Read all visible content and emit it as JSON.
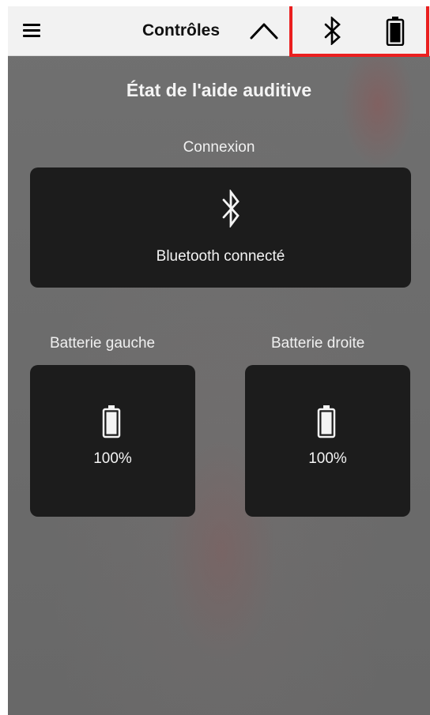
{
  "header": {
    "title": "Contrôles",
    "menu_icon": "hamburger-menu-icon",
    "collapse_icon": "chevron-up-icon",
    "status_icons": [
      "bluetooth-icon",
      "battery-full-icon"
    ],
    "highlight_color": "#ea1f1f"
  },
  "main": {
    "heading": "État de l'aide auditive",
    "connection": {
      "label": "Connexion",
      "status": "Bluetooth connecté",
      "icon": "bluetooth-icon"
    },
    "battery_left": {
      "label": "Batterie gauche",
      "value": "100%",
      "icon": "battery-icon"
    },
    "battery_right": {
      "label": "Batterie droite",
      "value": "100%",
      "icon": "battery-icon"
    }
  },
  "colors": {
    "header_bg": "#f2f2f2",
    "screen_bg": "#6e6e6e",
    "card_bg": "#1c1c1c",
    "text_light": "#f4f4f4"
  }
}
